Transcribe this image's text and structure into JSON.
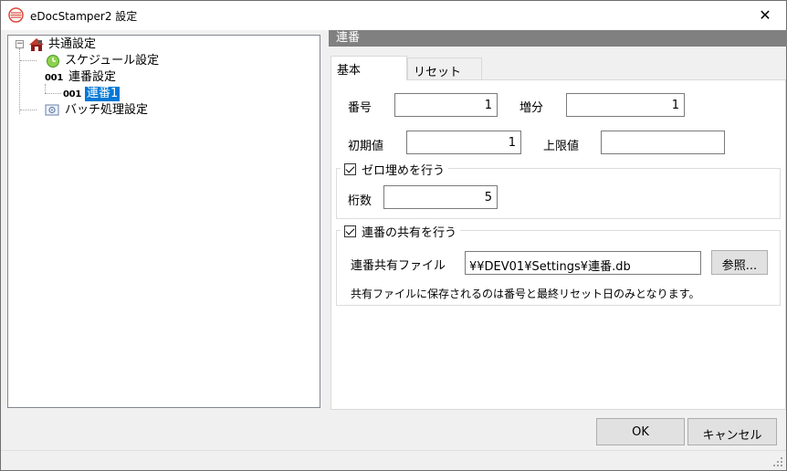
{
  "window": {
    "title": "eDocStamper2 設定",
    "close_glyph": "✕"
  },
  "tree": {
    "items": [
      {
        "label": "共通設定",
        "icon": "home-settings-icon"
      },
      {
        "label": "スケジュール設定",
        "icon": "clock-icon"
      },
      {
        "label": "連番設定",
        "icon_text": "001"
      },
      {
        "label": "連番1",
        "icon_text": "001",
        "selected": true
      },
      {
        "label": "バッチ処理設定",
        "icon": "batch-icon"
      }
    ],
    "expander_glyph": "−"
  },
  "section": {
    "title": "連番"
  },
  "tabs": [
    {
      "label": "基本",
      "active": true
    },
    {
      "label": "リセット",
      "active": false
    }
  ],
  "basic": {
    "number_label": "番号",
    "number_value": "1",
    "increment_label": "増分",
    "increment_value": "1",
    "initial_label": "初期値",
    "initial_value": "1",
    "upper_label": "上限値",
    "upper_value": "",
    "zero_pad": {
      "legend": "ゼロ埋めを行う",
      "checked": true,
      "digits_label": "桁数",
      "digits_value": "5"
    },
    "share": {
      "legend": "連番の共有を行う",
      "checked": true,
      "file_label": "連番共有ファイル",
      "file_value": "¥¥DEV01¥Settings¥連番.db",
      "browse_label": "参照...",
      "note": "共有ファイルに保存されるのは番号と最終リセット日のみとなります。"
    }
  },
  "footer": {
    "ok_label": "OK",
    "cancel_label": "キャンセル"
  },
  "colors": {
    "selection": "#0078d7",
    "section_bar": "#808080"
  }
}
